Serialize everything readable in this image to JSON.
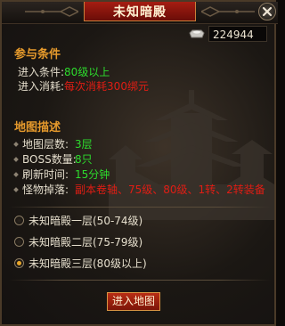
{
  "window": {
    "title": "未知暗殿"
  },
  "currency": {
    "icon": "silver-ingot-icon",
    "amount": "224944"
  },
  "requirements": {
    "heading": "参与条件",
    "entry_condition": {
      "label": "进入条件:",
      "value": "80级以上"
    },
    "entry_cost": {
      "label": "进入消耗:",
      "value": "每次消耗300绑元"
    }
  },
  "map_info": {
    "heading": "地图描述",
    "floors": {
      "label": "地图层数:",
      "value": "3层"
    },
    "boss_count": {
      "label": "BOSS数量:",
      "value": "8只"
    },
    "refresh": {
      "label": "刷新时间:",
      "value": "15分钟"
    },
    "drops": {
      "label": "怪物掉落:",
      "value": "副本卷轴、75级、80级、1转、2转装备"
    }
  },
  "floor_options": [
    {
      "label": "未知暗殿一层(50-74级)",
      "selected": false
    },
    {
      "label": "未知暗殿二层(75-79级)",
      "selected": false
    },
    {
      "label": "未知暗殿三层(80级以上)",
      "selected": true
    }
  ],
  "actions": {
    "enter_label": "进入地图"
  },
  "colors": {
    "accent": "#e69a2c",
    "green": "#2ddc2d",
    "red": "#e01d14",
    "title_plate": "#a51d12"
  }
}
